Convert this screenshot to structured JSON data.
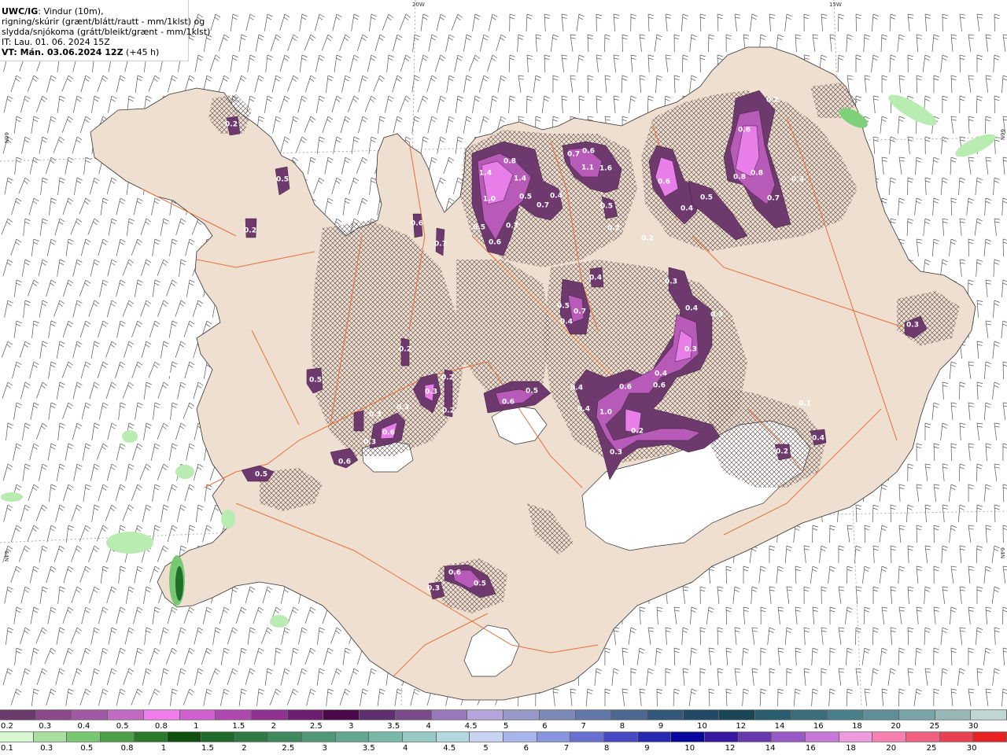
{
  "header": {
    "title_bold": "UWC/IG",
    "title_rest": ": Vindur (10m),",
    "line2": "rigning/skúrir (grænt/blátt/rautt - mm/1klst) og",
    "line3": "slydda/snjókoma (grátt/bleikt/grænt - mm/1klst)",
    "line4": "IT: Lau. 01. 06. 2024 15Z",
    "line5_bold": "VT: Mán. 03.06.2024 12Z",
    "line5_rest": " (+45 h)"
  },
  "map": {
    "graticule": {
      "top_labels": [
        "20W",
        "15W"
      ],
      "left_labels": [
        "66N",
        "64N"
      ],
      "right_labels": [
        "66N",
        "64N"
      ]
    },
    "land_color": "#efdfd0",
    "glacier_color": "#ffffff",
    "road_color": "#e8703a",
    "snow_dark": "#6e3a6e",
    "snow_mid": "#b85bb8",
    "snow_light": "#e87fe8",
    "rain_light": "#b8ecb0",
    "rain_dark": "#1f6e2a",
    "precip_labels": [
      {
        "text": "0.2",
        "c": [
          982,
          127
        ]
      },
      {
        "text": "0.6",
        "c": [
          946,
          165
        ]
      },
      {
        "text": "0.8",
        "c": [
          962,
          220
        ]
      },
      {
        "text": "0.8",
        "c": [
          940,
          225
        ]
      },
      {
        "text": "0.7",
        "c": [
          983,
          252
        ]
      },
      {
        "text": "0.3",
        "c": [
          1014,
          228
        ]
      },
      {
        "text": "0.6",
        "c": [
          844,
          231
        ]
      },
      {
        "text": "0.5",
        "c": [
          898,
          251
        ]
      },
      {
        "text": "0.4",
        "c": [
          873,
          265
        ]
      },
      {
        "text": "0.8",
        "c": [
          648,
          205
        ]
      },
      {
        "text": "1.4",
        "c": [
          617,
          220
        ]
      },
      {
        "text": "1.4",
        "c": [
          661,
          227
        ]
      },
      {
        "text": "1.0",
        "c": [
          622,
          253
        ]
      },
      {
        "text": "0.5",
        "c": [
          668,
          250
        ]
      },
      {
        "text": "0.4",
        "c": [
          707,
          249
        ]
      },
      {
        "text": "0.7",
        "c": [
          690,
          261
        ]
      },
      {
        "text": "0.5",
        "c": [
          609,
          289
        ]
      },
      {
        "text": "0.7",
        "c": [
          651,
          287
        ]
      },
      {
        "text": "0.6",
        "c": [
          629,
          308
        ]
      },
      {
        "text": "0.7",
        "c": [
          729,
          196
        ]
      },
      {
        "text": "0.6",
        "c": [
          748,
          192
        ]
      },
      {
        "text": "1.6",
        "c": [
          770,
          214
        ]
      },
      {
        "text": "1.1",
        "c": [
          747,
          213
        ]
      },
      {
        "text": "0.5",
        "c": [
          771,
          262
        ]
      },
      {
        "text": "0.2",
        "c": [
          780,
          290
        ]
      },
      {
        "text": "0.2",
        "c": [
          823,
          303
        ]
      },
      {
        "text": "0.2",
        "c": [
          294,
          158
        ]
      },
      {
        "text": "0.5",
        "c": [
          359,
          228
        ]
      },
      {
        "text": "0.2",
        "c": [
          318,
          293
        ]
      },
      {
        "text": "0.6",
        "c": [
          530,
          284
        ]
      },
      {
        "text": "0.7",
        "c": [
          560,
          310
        ]
      },
      {
        "text": "0.4",
        "c": [
          757,
          353
        ]
      },
      {
        "text": "0.3",
        "c": [
          853,
          358
        ]
      },
      {
        "text": "0.5",
        "c": [
          716,
          389
        ]
      },
      {
        "text": "0.7",
        "c": [
          737,
          396
        ]
      },
      {
        "text": "0.4",
        "c": [
          720,
          409
        ]
      },
      {
        "text": "0.4",
        "c": [
          879,
          392
        ]
      },
      {
        "text": "0.3",
        "c": [
          911,
          400
        ]
      },
      {
        "text": "0.3",
        "c": [
          878,
          444
        ]
      },
      {
        "text": "0.3",
        "c": [
          1160,
          413
        ]
      },
      {
        "text": "0.2",
        "c": [
          515,
          444
        ]
      },
      {
        "text": "0.3",
        "c": [
          223,
          477
        ]
      },
      {
        "text": "0.5",
        "c": [
          401,
          483
        ]
      },
      {
        "text": "0.4",
        "c": [
          840,
          475
        ]
      },
      {
        "text": "0.6",
        "c": [
          838,
          490
        ]
      },
      {
        "text": "0.6",
        "c": [
          795,
          492
        ]
      },
      {
        "text": "0.4",
        "c": [
          733,
          493
        ]
      },
      {
        "text": "0.5",
        "c": [
          676,
          497
        ]
      },
      {
        "text": "0.6",
        "c": [
          646,
          511
        ]
      },
      {
        "text": "0.3",
        "c": [
          548,
          498
        ]
      },
      {
        "text": "0.2",
        "c": [
          569,
          480
        ]
      },
      {
        "text": "0.3",
        "c": [
          512,
          518
        ]
      },
      {
        "text": "0.4",
        "c": [
          742,
          520
        ]
      },
      {
        "text": "1.0",
        "c": [
          770,
          524
        ]
      },
      {
        "text": "0.2",
        "c": [
          570,
          522
        ]
      },
      {
        "text": "0.1",
        "c": [
          1023,
          513
        ]
      },
      {
        "text": "0.3",
        "c": [
          477,
          527
        ]
      },
      {
        "text": "0.6",
        "c": [
          494,
          550
        ]
      },
      {
        "text": "0.2",
        "c": [
          810,
          548
        ]
      },
      {
        "text": "0.3",
        "c": [
          470,
          562
        ]
      },
      {
        "text": "0.6",
        "c": [
          438,
          587
        ]
      },
      {
        "text": "0.3",
        "c": [
          783,
          575
        ]
      },
      {
        "text": "0.4",
        "c": [
          1040,
          557
        ]
      },
      {
        "text": "0.2",
        "c": [
          994,
          574
        ]
      },
      {
        "text": "0.5",
        "c": [
          332,
          603
        ]
      },
      {
        "text": "0.6",
        "c": [
          578,
          728
        ]
      },
      {
        "text": "0.5",
        "c": [
          610,
          742
        ]
      },
      {
        "text": "0.3",
        "c": [
          551,
          748
        ]
      }
    ]
  },
  "legend": {
    "snow_colors": [
      "#6a3a6a",
      "#8a4a8a",
      "#a258a2",
      "#c26ac2",
      "#f07cf0",
      "#d060d0",
      "#b048b0",
      "#903090",
      "#6e1e6e",
      "#4a0a4a",
      "#5e2e6e",
      "#7a4a8a",
      "#9878b8",
      "#b4a4dc",
      "#9898c8",
      "#7c88b8",
      "#6278a8",
      "#4a6890",
      "#34587a",
      "#224a66",
      "#1a4658",
      "#2a5e6e",
      "#3a6e7a",
      "#4a7e88",
      "#5e8e96",
      "#7aa4a8",
      "#98b8b8",
      "#c0d6d4"
    ],
    "snow_labels": [
      "0.2",
      "0.3",
      "0.4",
      "0.5",
      "0.8",
      "1",
      "1.5",
      "2",
      "2.5",
      "3",
      "3.5",
      "4",
      "4.5",
      "5",
      "6",
      "7",
      "8",
      "9",
      "10",
      "12",
      "14",
      "16",
      "18",
      "20",
      "25",
      "30"
    ],
    "rain_colors": [
      "#d8f6d0",
      "#a8e0a0",
      "#78c872",
      "#4ca048",
      "#2a7a2a",
      "#10500e",
      "#1e6a2a",
      "#2e7a44",
      "#3e8a5e",
      "#4e9878",
      "#62a890",
      "#78b8a8",
      "#96c8c4",
      "#b4d8e0",
      "#c8d4f4",
      "#a8b4ec",
      "#8894e0",
      "#6870d4",
      "#4848c4",
      "#2828b0",
      "#0808a0",
      "#3818a0",
      "#6838b0",
      "#9858c8",
      "#c878d8",
      "#f098e0",
      "#f880b0",
      "#f06080",
      "#e84050",
      "#e82020"
    ],
    "rain_labels": [
      "0.1",
      "0.3",
      "0.5",
      "0.8",
      "1",
      "1.5",
      "2",
      "2.5",
      "3",
      "3.5",
      "4",
      "4.5",
      "5",
      "6",
      "7",
      "8",
      "9",
      "10",
      "12",
      "14",
      "16",
      "18",
      "20",
      "25",
      "30"
    ]
  }
}
